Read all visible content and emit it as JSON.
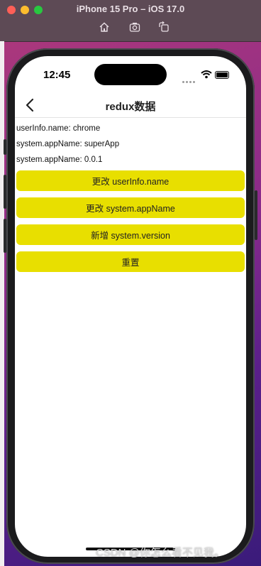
{
  "window": {
    "title": "iPhone 15 Pro – iOS 17.0"
  },
  "status_bar": {
    "time": "12:45"
  },
  "nav": {
    "title": "redux数据"
  },
  "info": [
    "userInfo.name: chrome",
    "system.appName: superApp",
    "system.appName: 0.0.1"
  ],
  "buttons": [
    "更改 userInfo.name",
    "更改 system.appName",
    "新增 system.version",
    "重置"
  ],
  "watermark": "CSDN @你怎么看不见我。",
  "colors": {
    "button_bg": "#e8df00"
  }
}
